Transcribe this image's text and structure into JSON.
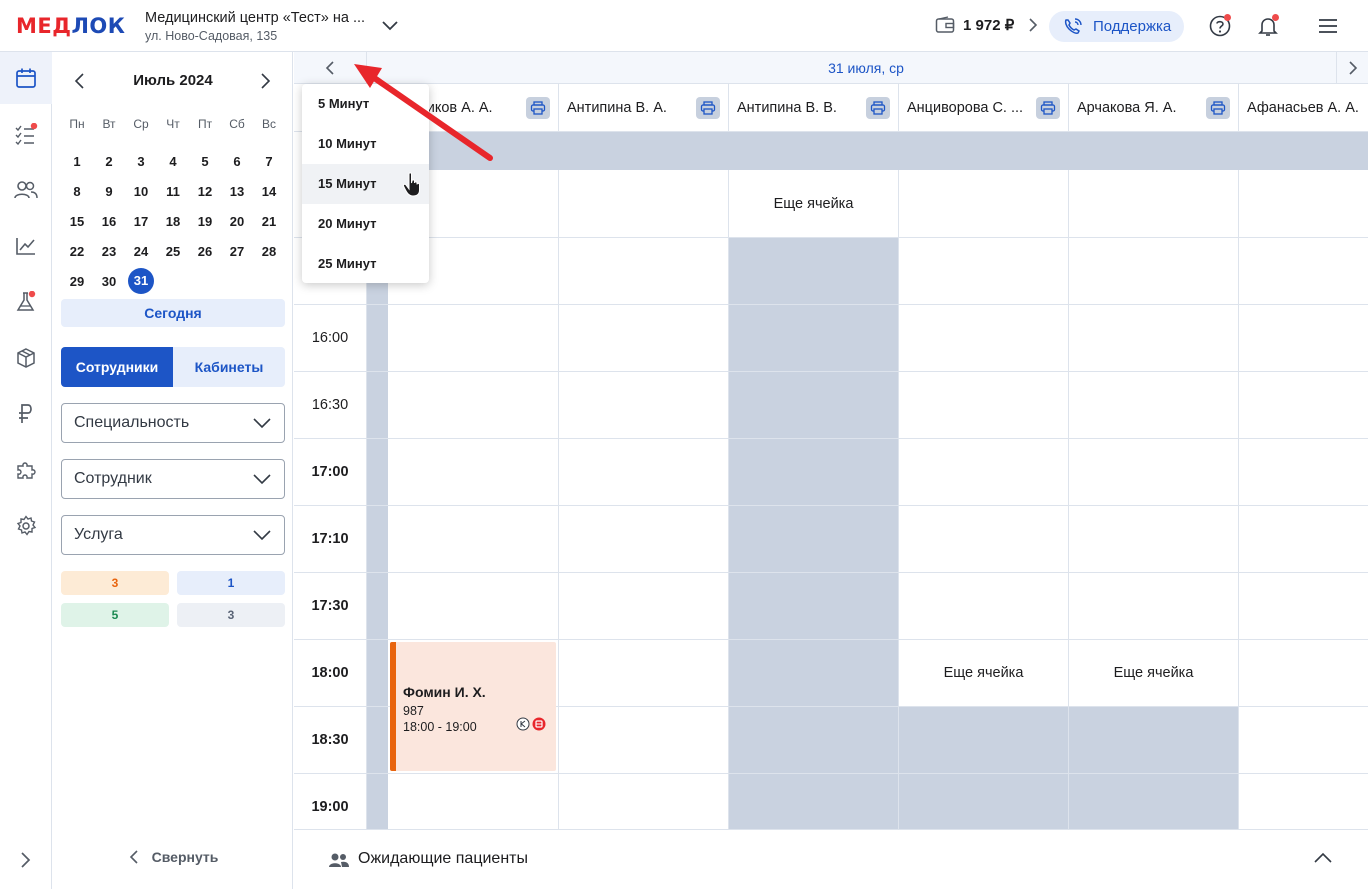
{
  "header": {
    "logo_left": "МЕД",
    "logo_right": "ЛОК",
    "clinic_name": "Медицинский центр «Тест» на ...",
    "clinic_address": "ул. Ново-Садовая, 135",
    "balance": "1 972 ₽",
    "support_label": "Поддержка",
    "icons": [
      "wallet-icon",
      "chevron-right-icon",
      "phone-support-icon",
      "help-icon",
      "bell-icon",
      "menu-icon"
    ],
    "colors": {
      "brand_red": "#e8262b",
      "brand_blue": "#1d55c6",
      "notification": "#ef4b4b"
    }
  },
  "rail": {
    "icons": [
      "calendar-icon",
      "tasks-icon",
      "users-icon",
      "chart-icon",
      "lab-flask-icon",
      "box-icon",
      "ruble-icon",
      "puzzle-icon",
      "settings-icon",
      "expand-icon"
    ]
  },
  "calendar": {
    "title": "Июль 2024",
    "weekdays": [
      "Пн",
      "Вт",
      "Ср",
      "Чт",
      "Пт",
      "Сб",
      "Вс"
    ],
    "weeks": [
      [
        "1",
        "2",
        "3",
        "4",
        "5",
        "6",
        "7"
      ],
      [
        "8",
        "9",
        "10",
        "11",
        "12",
        "13",
        "14"
      ],
      [
        "15",
        "16",
        "17",
        "18",
        "19",
        "20",
        "21"
      ],
      [
        "22",
        "23",
        "24",
        "25",
        "26",
        "27",
        "28"
      ],
      [
        "29",
        "30",
        "31",
        "",
        "",
        "",
        ""
      ]
    ],
    "selected_day": "31",
    "today_label": "Сегодня"
  },
  "filters": {
    "tab_staff": "Сотрудники",
    "tab_rooms": "Кабинеты",
    "specialty": "Специальность",
    "employee": "Сотрудник",
    "service": "Услуга"
  },
  "counters": [
    {
      "value": "3",
      "color": "#e8640e",
      "bg": "#fdebd6"
    },
    {
      "value": "1",
      "color": "#1d55c6",
      "bg": "#e7eefb"
    },
    {
      "value": "5",
      "color": "#1b8a52",
      "bg": "#dff3e8"
    },
    {
      "value": "3",
      "color": "#5a6476",
      "bg": "#edf0f5"
    }
  ],
  "collapse_label": "Свернуть",
  "schedule": {
    "date": "31 июля, ср",
    "columns": [
      "Алтиников А. А.",
      "Антипина В. А.",
      "Антипина В. В.",
      "Анциворова С. ...",
      "Арчакова Я. А.",
      "Афанасьев А. А."
    ],
    "visible_column_label_first": "итиков А. А.",
    "times": [
      "16:00",
      "16:30",
      "17:00",
      "17:10",
      "17:30",
      "18:00",
      "18:30",
      "19:00"
    ],
    "more_cell_label": "Еще ячейка",
    "appointment": {
      "name": "Фомин И. Х.",
      "number": "987",
      "time": "18:00 - 19:00"
    }
  },
  "interval_dropdown": {
    "items": [
      "5 Минут",
      "10 Минут",
      "15 Минут",
      "20 Минут",
      "25 Минут"
    ],
    "hovered": "15 Минут"
  },
  "waiting_label": "Ожидающие пациенты"
}
